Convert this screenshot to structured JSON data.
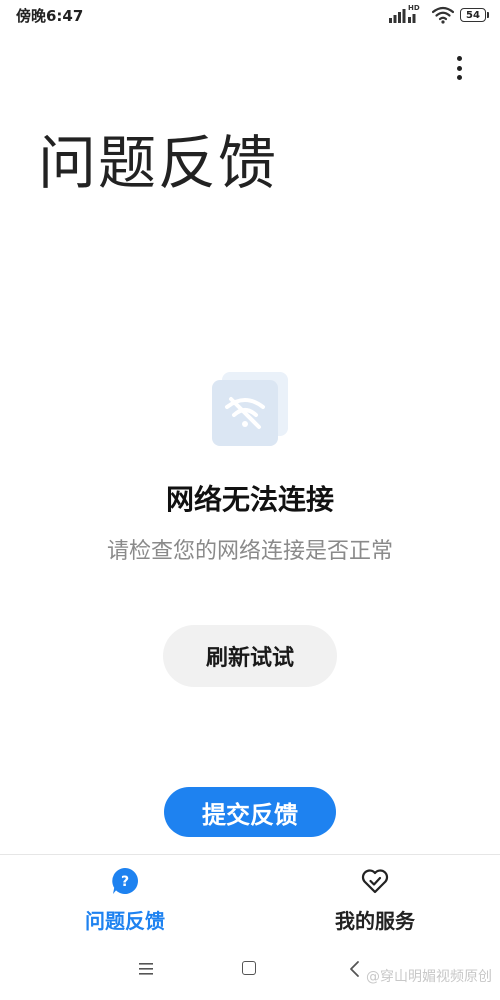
{
  "status_bar": {
    "time": "傍晚6:47",
    "network": "HD",
    "battery": "54"
  },
  "header": {
    "title": "问题反馈"
  },
  "empty_state": {
    "icon": "wifi-off-icon",
    "title": "网络无法连接",
    "subtitle": "请检查您的网络连接是否正常",
    "refresh_label": "刷新试试"
  },
  "submit_label": "提交反馈",
  "tabs": [
    {
      "label": "问题反馈",
      "icon": "question-bubble-icon",
      "active": true
    },
    {
      "label": "我的服务",
      "icon": "heart-check-icon",
      "active": false
    }
  ],
  "watermark": "@穿山明媚视频原创",
  "colors": {
    "accent": "#1e82f0",
    "refresh_bg": "#f1f1f1",
    "subtitle": "#8a8a8a",
    "icon_tint": "#dbe6f3"
  }
}
